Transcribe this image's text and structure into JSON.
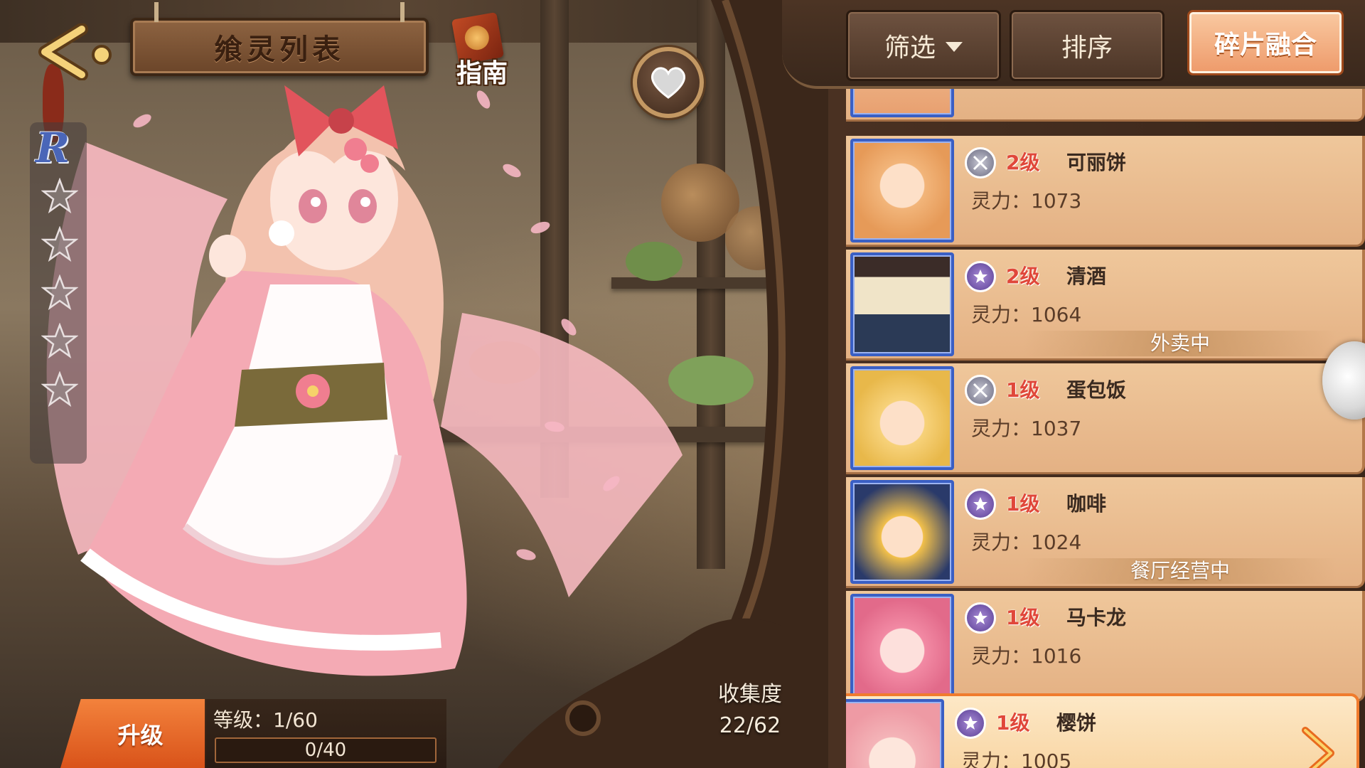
{
  "header": {
    "title": "飨灵列表",
    "guide_label": "指南"
  },
  "character": {
    "rarity": "R",
    "stars_total": 5,
    "stars_filled": 0
  },
  "level_panel": {
    "upgrade_label": "升级",
    "level_text": "等级：1/60",
    "exp_text": "0/40",
    "exp_fraction": 0
  },
  "collection": {
    "label": "收集度",
    "value": "22/62"
  },
  "toolbar": {
    "filter_label": "筛选",
    "sort_label": "排序",
    "fuse_label": "碎片融合"
  },
  "list": {
    "cards": [
      {
        "level": "2级",
        "name": "可丽饼",
        "power": "灵力：1073",
        "type": "sword",
        "status": ""
      },
      {
        "level": "2级",
        "name": "清酒",
        "power": "灵力：1064",
        "type": "star",
        "status": "外卖中"
      },
      {
        "level": "1级",
        "name": "蛋包饭",
        "power": "灵力：1037",
        "type": "sword",
        "status": ""
      },
      {
        "level": "1级",
        "name": "咖啡",
        "power": "灵力：1024",
        "type": "star",
        "status": "餐厅经营中"
      },
      {
        "level": "1级",
        "name": "马卡龙",
        "power": "灵力：1016",
        "type": "star",
        "status": ""
      },
      {
        "level": "1级",
        "name": "樱饼",
        "power": "灵力：1005",
        "type": "star",
        "status": ""
      }
    ]
  },
  "colors": {
    "accent_orange": "#f07b2d",
    "card_bg": "#efc79b",
    "portrait_border": "#3a5fc4",
    "level_red": "#e0473a"
  },
  "icons": [
    "back-arrow-icon",
    "guide-book-icon",
    "heart-icon",
    "rarity-r-icon",
    "star-icon",
    "sword-class-icon",
    "star-class-icon",
    "dropdown-icon",
    "next-arrow-icon"
  ]
}
